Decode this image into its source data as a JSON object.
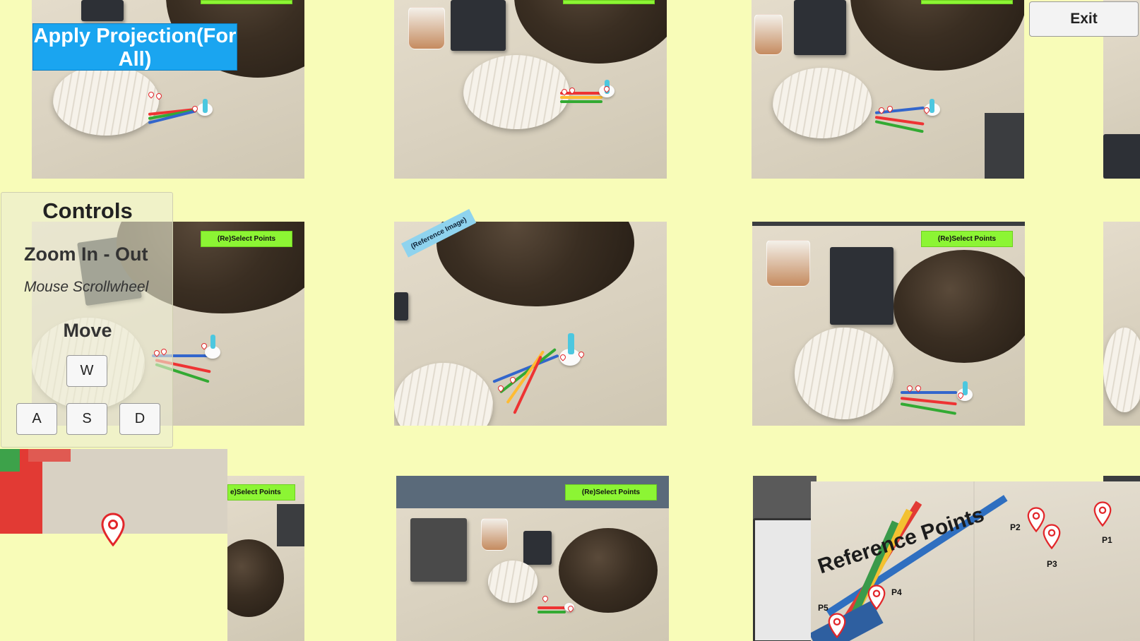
{
  "toolbar": {
    "apply_label": "Apply Projection(For All)",
    "exit_label": "Exit"
  },
  "grid": {
    "reselect_label": "(Re)Select Points",
    "reselect_partial_label": "e)Select Points",
    "reference_tag": "(Reference Image)"
  },
  "controls": {
    "title": "Controls",
    "zoom_label": "Zoom In - Out",
    "zoom_hint": "Mouse Scrollwheel",
    "move_label": "Move",
    "keys": [
      "W",
      "A",
      "S",
      "D"
    ]
  },
  "reference_panel": {
    "title": "Reference Points",
    "points": [
      "P1",
      "P2",
      "P3",
      "P4",
      "P5"
    ]
  },
  "colors": {
    "background": "#f8fcb8",
    "apply_button": "#1aa5f0",
    "select_button": "#8cf534",
    "reference_tag": "#8fd3ee",
    "pin": "#e2262a"
  },
  "icons": [
    "map-pin-icon"
  ]
}
